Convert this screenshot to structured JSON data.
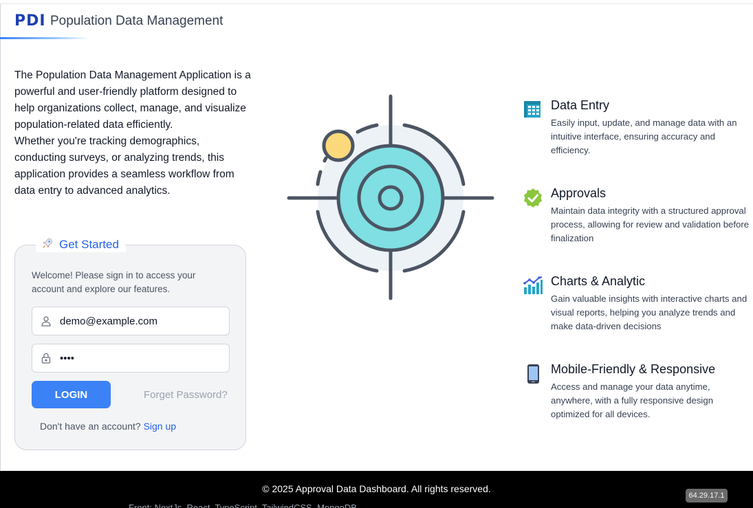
{
  "header": {
    "logo_text": "PDI",
    "title": "Population Data Management"
  },
  "intro": {
    "paragraph1": "The Population Data Management Application is a powerful and user-friendly platform designed to help organizations collect, manage, and visualize population-related data efficiently.",
    "paragraph2": "Whether you're tracking demographics, conducting surveys, or analyzing trends, this application provides a seamless workflow from data entry to advanced analytics."
  },
  "login": {
    "legend": "Get Started",
    "welcome": "Welcome! Please sign in to access your account and explore our features.",
    "email_value": "demo@example.com",
    "password_value": "demo",
    "login_label": "LOGIN",
    "forget_label": "Forget Password?",
    "signup_prompt": "Don't have an account?",
    "signup_link": "Sign up"
  },
  "features": [
    {
      "icon": "spreadsheet-icon",
      "title": "Data Entry",
      "description": "Easily input, update, and manage data with an intuitive interface, ensuring accuracy and efficiency."
    },
    {
      "icon": "check-badge-icon",
      "title": "Approvals",
      "description": "Maintain data integrity with a structured approval process, allowing for review and validation before finalization"
    },
    {
      "icon": "bar-chart-icon",
      "title": "Charts & Analytic",
      "description": "Gain valuable insights with interactive charts and visual reports, helping you analyze trends and make data-driven decisions"
    },
    {
      "icon": "mobile-phone-icon",
      "title": "Mobile-Friendly & Responsive",
      "description": "Access and manage your data anytime, anywhere, with a fully responsive design optimized for all devices."
    }
  ],
  "footer": {
    "copyright": "© 2025 Approval Data Dashboard. All rights reserved.",
    "tech_stack": "Front: NextJs. React. TypeScript. TailwindCSS. MongoDB.",
    "version": "64.29.17.1"
  },
  "colors": {
    "accent": "#3b82f6",
    "brand": "#1e40af",
    "target_fill": "#7fdfe3",
    "target_stroke": "#4b5563",
    "sun": "#fcd97a",
    "check_green": "#8cc63f"
  }
}
